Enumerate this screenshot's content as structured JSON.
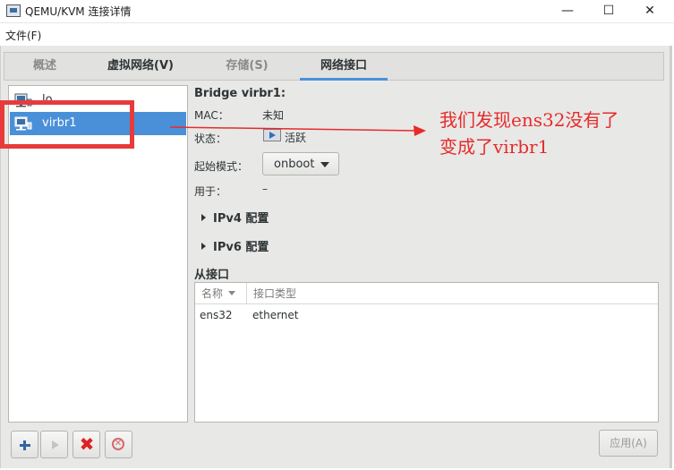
{
  "window": {
    "title": "QEMU/KVM 连接详情",
    "minimize": "—",
    "maximize": "☐",
    "close": "✕"
  },
  "menu": {
    "file": "文件(F)"
  },
  "tabs": [
    {
      "label": "概述"
    },
    {
      "label": "虚拟网络(V)"
    },
    {
      "label": "存储(S)"
    },
    {
      "label": "网络接口"
    }
  ],
  "interfaces": [
    {
      "label": "lo"
    },
    {
      "label": "virbr1"
    }
  ],
  "details": {
    "title": "Bridge virbr1:",
    "mac_label": "MAC：",
    "mac_value": "未知",
    "state_label": "状态：",
    "state_value": "活跃",
    "start_mode_label": "起始模式：",
    "start_mode_value": "onboot",
    "used_by_label": "用于：",
    "used_by_value": "–",
    "ipv4": "IPv4 配置",
    "ipv6": "IPv6 配置"
  },
  "slave_interfaces": {
    "title": "从接口",
    "columns": [
      "名称",
      "接口类型"
    ],
    "rows": [
      {
        "name": "ens32",
        "type": "ethernet"
      }
    ]
  },
  "toolbar": {
    "apply": "应用(A)"
  },
  "annotation": {
    "line1": "我们发现ens32没有了",
    "line2": "变成了virbr1"
  },
  "colors": {
    "accent": "#4a90d9",
    "annotation": "#e62b2b"
  }
}
